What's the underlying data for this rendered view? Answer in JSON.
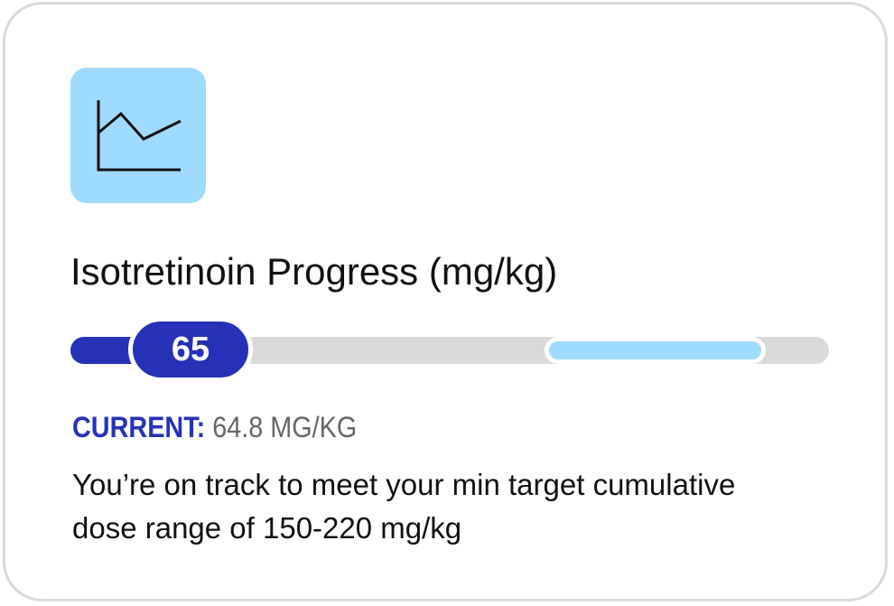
{
  "card": {
    "icon": "line-chart-icon",
    "title": "Isotretinoin Progress (mg/kg)",
    "progress": {
      "scale_max": 240,
      "current_value": 64.8,
      "badge_label": "65",
      "target_min": 150,
      "target_max": 220
    },
    "current_label": "CURRENT:",
    "current_value_text": "64.8 MG/KG",
    "description": "You’re on track to meet your min target cumulative dose range of 150-220 mg/kg"
  },
  "colors": {
    "accent_dark": "#2532b8",
    "accent_light": "#9fdbff",
    "track": "#d9d9d9",
    "text": "#111111",
    "muted": "#666666"
  }
}
